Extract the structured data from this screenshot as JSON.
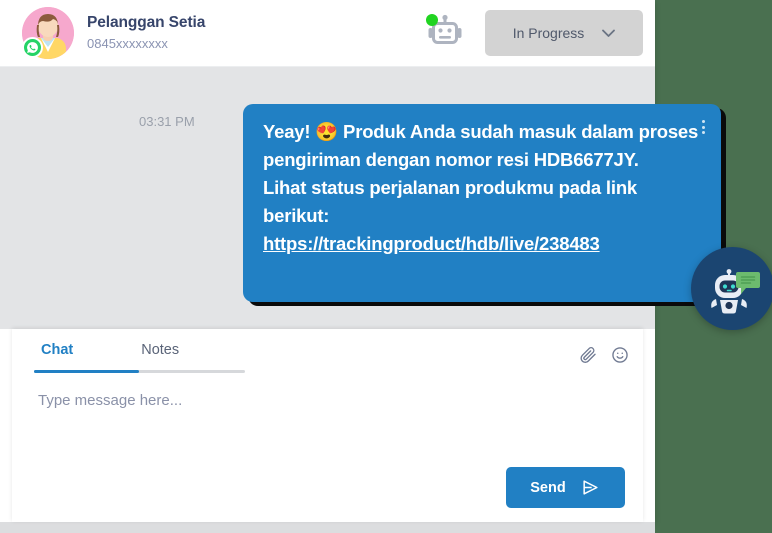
{
  "header": {
    "contact_name": "Pelanggan Setia",
    "contact_phone": "0845xxxxxxxx",
    "avatar_icon": "customer-avatar",
    "channel_badge_icon": "whatsapp-icon",
    "bot_icon": "robot-icon",
    "bot_online_indicator": "online-dot",
    "status": {
      "selected": "In Progress",
      "chevron_icon": "chevron-down-icon"
    }
  },
  "conversation": {
    "messages": [
      {
        "time": "03:31 PM",
        "menu_icon": "more-vertical-icon",
        "text": "Yeay! 😍 Produk Anda sudah masuk dalam proses pengiriman dengan nomor resi HDB6677JY.\nLihat status perjalanan produkmu pada link berikut:",
        "link": "https://trackingproduct/hdb/live/238483"
      }
    ]
  },
  "composer": {
    "tabs": [
      {
        "label": "Chat",
        "active": true
      },
      {
        "label": "Notes",
        "active": false
      }
    ],
    "attach_icon": "paperclip-icon",
    "emoji_icon": "emoji-smiley-icon",
    "input_placeholder": "Type message here...",
    "input_value": "",
    "send_label": "Send",
    "send_icon": "send-plane-icon"
  },
  "floating_widget": {
    "icon": "chatbot-widget-icon"
  },
  "colors": {
    "page_background": "#4a7050",
    "panel_background": "#ffffff",
    "chat_background": "#e3e4e6",
    "bubble_blue": "#2180c4",
    "accent_blue": "#2180c4",
    "status_chip": "#d3d3d3",
    "text_dark": "#37456b",
    "text_muted": "#8a93b2",
    "online_green": "#21d421",
    "whatsapp_green": "#25d366",
    "widget_navy": "#1b4571",
    "widget_bubble_green": "#6cbb6e"
  }
}
